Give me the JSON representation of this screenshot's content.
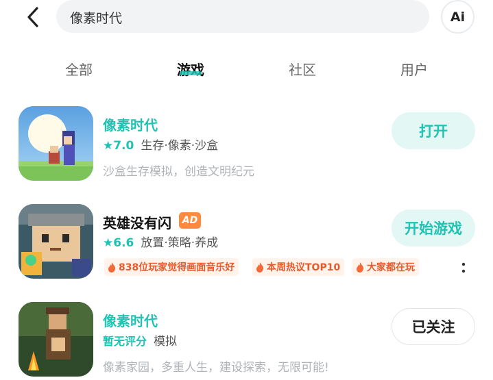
{
  "header": {
    "search_text": "像素时代",
    "ai_label": "Ai"
  },
  "tabs": [
    {
      "label": "全部",
      "active": false
    },
    {
      "label": "游戏",
      "active": true
    },
    {
      "label": "社区",
      "active": false
    },
    {
      "label": "用户",
      "active": false
    }
  ],
  "apps": [
    {
      "name": "像素时代",
      "score": "★7.0",
      "tags": "生存·像素·沙盒",
      "description": "沙盒生存模拟，创造文明纪元",
      "button": "打开"
    },
    {
      "name": "英雄没有闪",
      "ad_badge": "AD",
      "score": "★6.6",
      "tags": "放置·策略·养成",
      "hot_tags": [
        "838位玩家觉得画面音乐好",
        "本周热议TOP10",
        "大家都在玩"
      ],
      "button": "开始游戏"
    },
    {
      "name": "像素时代",
      "score": "暂无评分",
      "tags": "模拟",
      "description": "像素家园，多重人生，建设探索，无限可能!",
      "button": "已关注"
    }
  ],
  "colors": {
    "accent": "#1ec3b3",
    "accent_bg": "#e3f7f4",
    "ad_orange": "#ff8a3d",
    "hot_tag_text": "#e85a2b"
  }
}
